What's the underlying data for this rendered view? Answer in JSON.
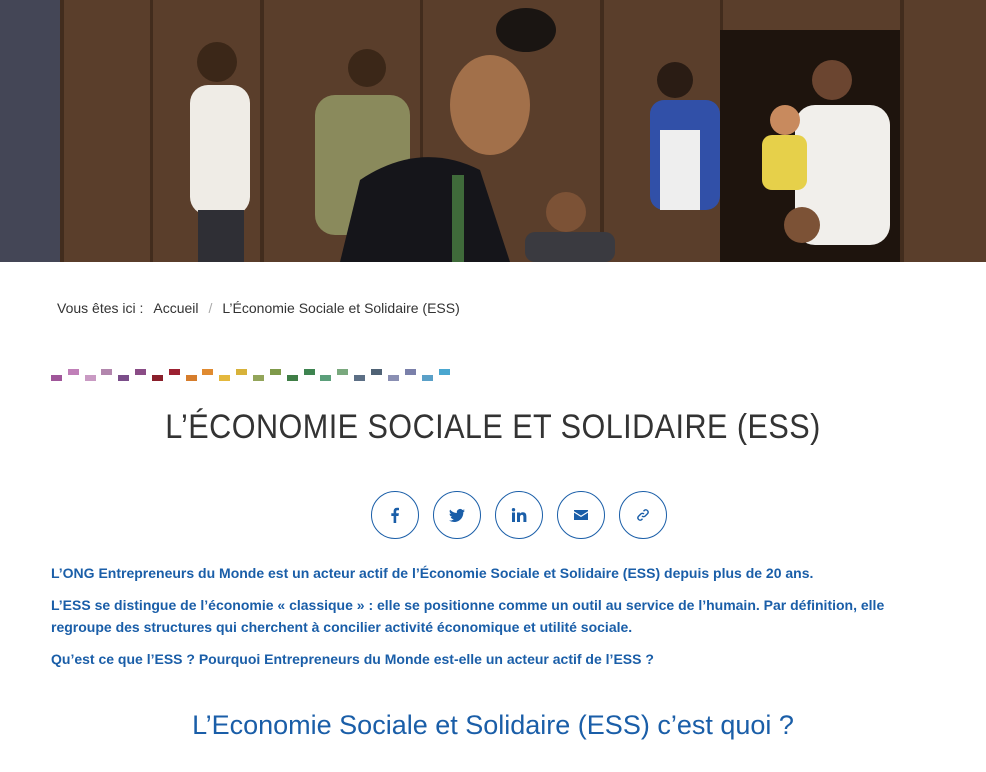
{
  "hero": {
    "alt": "Photo of villagers in front of a wooden house"
  },
  "breadcrumb": {
    "prefix": "Vous êtes ici :",
    "home": "Accueil",
    "separator": "/",
    "current": "L’Économie Sociale et Solidaire (ESS)"
  },
  "page": {
    "title": "L’ÉCONOMIE SOCIALE ET SOLIDAIRE (ESS)",
    "subtitle": "L’Economie Sociale et Solidaire (ESS) c’est quoi ?"
  },
  "share": {
    "items": [
      {
        "icon": "facebook-icon"
      },
      {
        "icon": "twitter-icon"
      },
      {
        "icon": "linkedin-icon"
      },
      {
        "icon": "email-icon"
      },
      {
        "icon": "link-icon"
      }
    ]
  },
  "intro": {
    "p1": "L’ONG Entrepreneurs du Monde est un acteur actif de l’Économie Sociale et Solidaire (ESS) depuis plus de 20 ans.",
    "p2": "L’ESS se distingue de l’économie « classique » : elle se positionne comme un outil au service de l’humain. Par définition, elle regroupe des structures qui cherchent à concilier activité économique et utilité sociale.",
    "p3": "Qu’est ce que l’ESS ? Pourquoi Entrepreneurs du Monde est-elle un acteur actif de l’ESS ?"
  },
  "colors": {
    "accent": "#1a5ea8",
    "text": "#333333"
  }
}
